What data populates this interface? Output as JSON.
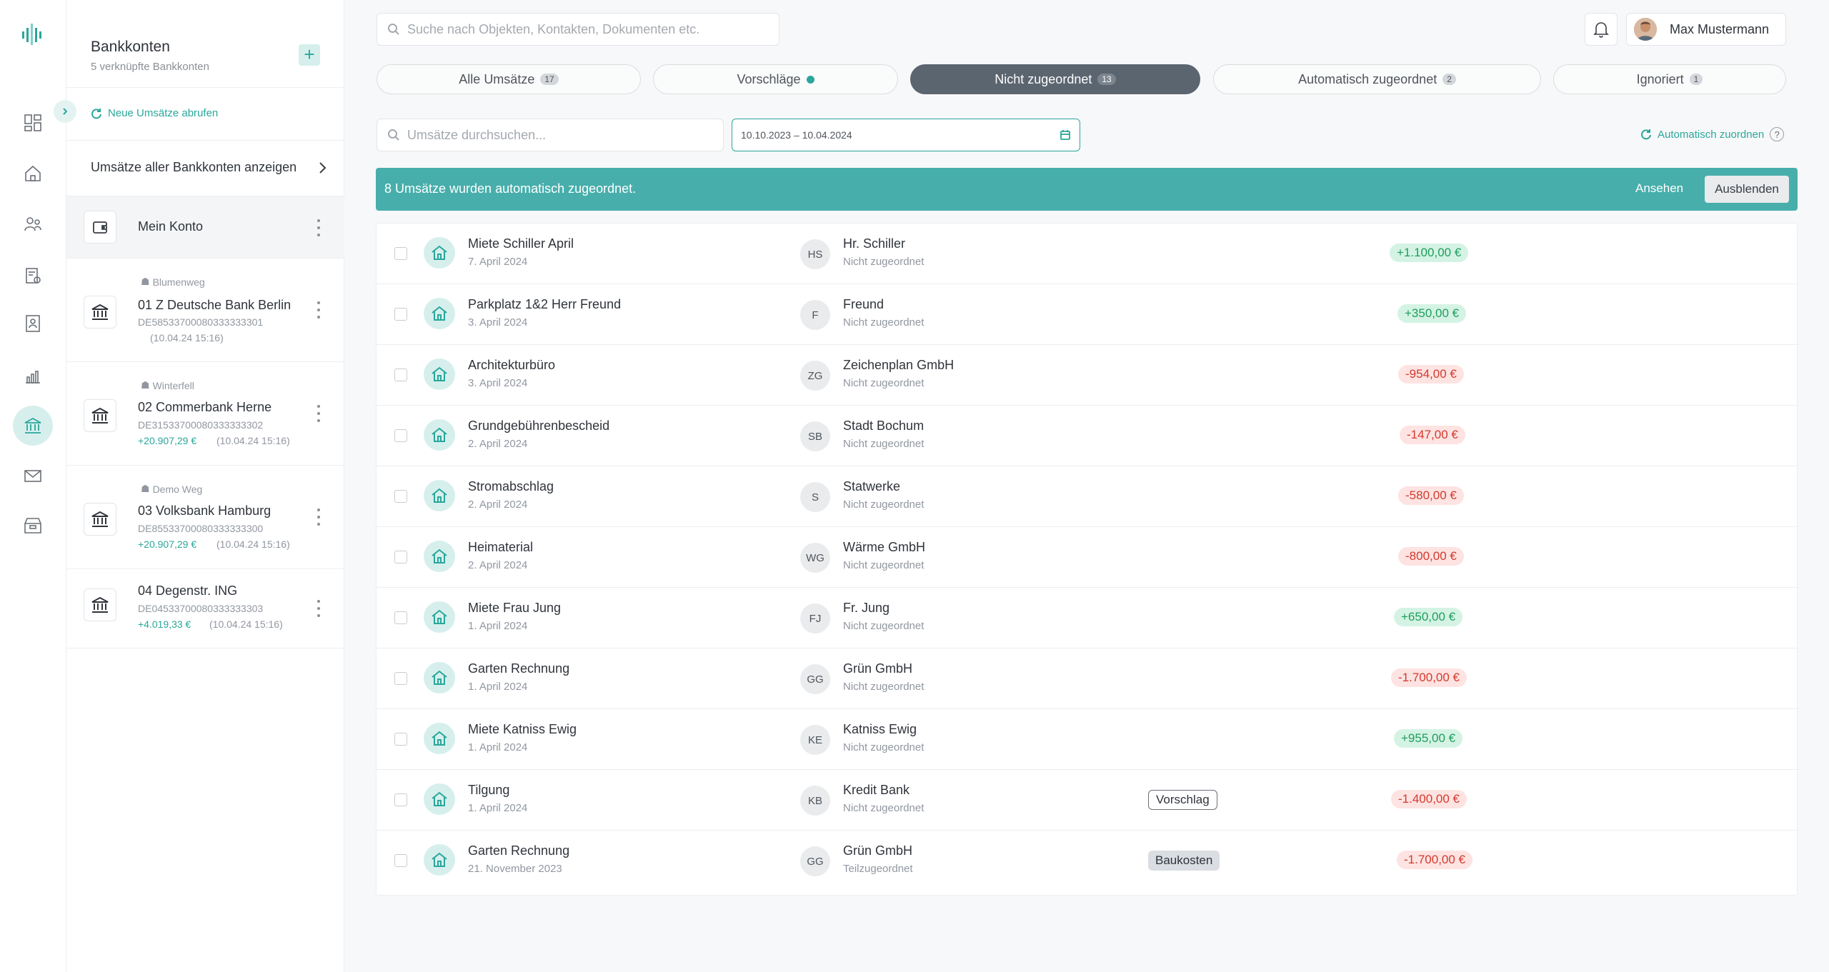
{
  "topbar": {
    "search_placeholder": "Suche nach Objekten, Kontakten, Dokumenten etc.",
    "user_name": "Max Mustermann"
  },
  "accounts_panel": {
    "title": "Bankkonten",
    "subtitle": "5 verknüpfte Bankkonten",
    "fetch_label": "Neue Umsätze abrufen",
    "all_accounts_label": "Umsätze aller Bankkonten anzeigen",
    "my_account": "Mein Konto",
    "accounts": [
      {
        "tag": "Blumenweg",
        "name": "01 Z Deutsche Bank Berlin",
        "iban": "DE58533700080333333301",
        "balance": "",
        "timestamp": "(10.04.24 15:16)"
      },
      {
        "tag": "Winterfell",
        "name": "02 Commerbank Herne",
        "iban": "DE31533700080333333302",
        "balance": "+20.907,29 €",
        "timestamp": "(10.04.24 15:16)"
      },
      {
        "tag": "Demo Weg",
        "name": "03 Volksbank Hamburg",
        "iban": "DE85533700080333333300",
        "balance": "+20.907,29 €",
        "timestamp": "(10.04.24 15:16)"
      },
      {
        "tag": "",
        "name": "04 Degenstr. ING",
        "iban": "DE04533700080333333303",
        "balance": "+4.019,33 €",
        "timestamp": "(10.04.24 15:16)"
      }
    ]
  },
  "tabs": [
    {
      "label": "Alle Umsätze",
      "badge": "17"
    },
    {
      "label": "Vorschläge",
      "badge": ""
    },
    {
      "label": "Nicht zugeordnet",
      "badge": "13"
    },
    {
      "label": "Automatisch zugeordnet",
      "badge": "2"
    },
    {
      "label": "Ignoriert",
      "badge": "1"
    }
  ],
  "filters": {
    "search_placeholder": "Umsätze durchsuchen...",
    "date_range": "10.10.2023 – 10.04.2024",
    "auto_assign": "Automatisch zuordnen",
    "help": "?"
  },
  "banner": {
    "message": "8 Umsätze wurden automatisch zugeordnet.",
    "view": "Ansehen",
    "hide": "Ausblenden"
  },
  "transactions": [
    {
      "title": "Miete Schiller April",
      "date": "7. April 2024",
      "initials": "HS",
      "contact": "Hr. Schiller",
      "status": "Nicht zugeordnet",
      "amount": "+1.100,00 €",
      "sign": "pos",
      "chip": ""
    },
    {
      "title": "Parkplatz 1&2 Herr Freund",
      "date": "3. April 2024",
      "initials": "F",
      "contact": "Freund",
      "status": "Nicht zugeordnet",
      "amount": "+350,00 €",
      "sign": "pos",
      "chip": ""
    },
    {
      "title": "Architekturbüro",
      "date": "3. April 2024",
      "initials": "ZG",
      "contact": "Zeichenplan GmbH",
      "status": "Nicht zugeordnet",
      "amount": "-954,00 €",
      "sign": "neg",
      "chip": ""
    },
    {
      "title": "Grundgebührenbescheid",
      "date": "2. April 2024",
      "initials": "SB",
      "contact": "Stadt Bochum",
      "status": "Nicht zugeordnet",
      "amount": "-147,00 €",
      "sign": "neg",
      "chip": ""
    },
    {
      "title": "Stromabschlag",
      "date": "2. April 2024",
      "initials": "S",
      "contact": "Statwerke",
      "status": "Nicht zugeordnet",
      "amount": "-580,00 €",
      "sign": "neg",
      "chip": ""
    },
    {
      "title": "Heimaterial",
      "date": "2. April 2024",
      "initials": "WG",
      "contact": "Wärme GmbH",
      "status": "Nicht zugeordnet",
      "amount": "-800,00 €",
      "sign": "neg",
      "chip": ""
    },
    {
      "title": "Miete Frau Jung",
      "date": "1. April 2024",
      "initials": "FJ",
      "contact": "Fr. Jung",
      "status": "Nicht zugeordnet",
      "amount": "+650,00 €",
      "sign": "pos",
      "chip": ""
    },
    {
      "title": "Garten Rechnung",
      "date": "1. April 2024",
      "initials": "GG",
      "contact": "Grün GmbH",
      "status": "Nicht zugeordnet",
      "amount": "-1.700,00 €",
      "sign": "neg",
      "chip": ""
    },
    {
      "title": "Miete Katniss Ewig",
      "date": "1. April 2024",
      "initials": "KE",
      "contact": "Katniss Ewig",
      "status": "Nicht zugeordnet",
      "amount": "+955,00 €",
      "sign": "pos",
      "chip": ""
    },
    {
      "title": "Tilgung",
      "date": "1. April 2024",
      "initials": "KB",
      "contact": "Kredit Bank",
      "status": "Nicht zugeordnet",
      "amount": "-1.400,00 €",
      "sign": "neg",
      "chip": "Vorschlag",
      "chip_style": "outline"
    },
    {
      "title": "Garten Rechnung",
      "date": "21. November 2023",
      "initials": "GG",
      "contact": "Grün GmbH",
      "status": "Teilzugeordnet",
      "amount": "-1.700,00 €",
      "sign": "neg",
      "chip": "Baukosten",
      "chip_style": "filled"
    }
  ],
  "colors": {
    "accent": "#2aa79a",
    "banner": "#47aeab",
    "active_tab": "#5b6570",
    "positive": "#1f9d5c",
    "negative": "#d33a2f"
  },
  "icons": [
    "logo-icon",
    "dashboard-icon",
    "home-icon",
    "contacts-icon",
    "documents-icon",
    "tenant-icon",
    "chart-icon",
    "bank-icon",
    "mail-icon",
    "archive-icon",
    "search-icon",
    "bell-icon",
    "plus-icon",
    "refresh-icon",
    "chevron-right-icon",
    "wallet-icon",
    "bank-building-icon",
    "kebab-icon",
    "calendar-icon",
    "house-icon"
  ]
}
